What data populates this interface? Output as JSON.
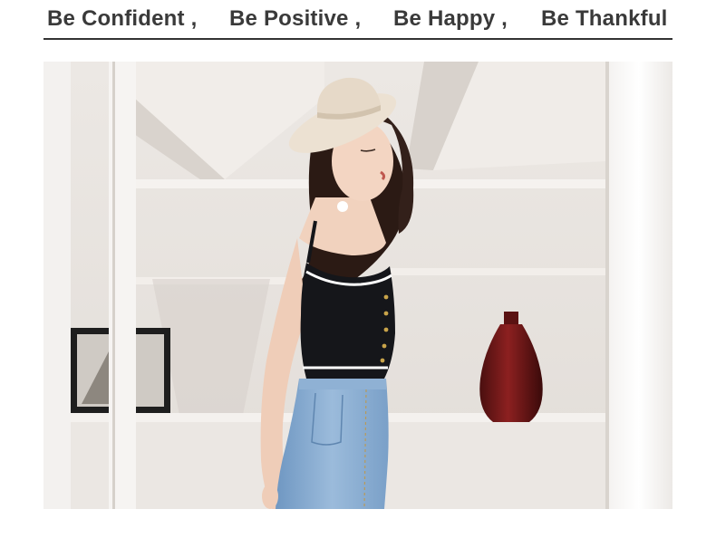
{
  "slogans": [
    "Be Confident ,",
    "Be Positive ,",
    "Be Happy ,",
    "Be Thankful"
  ],
  "photo": {
    "subject_icon": "model-photo-icon"
  },
  "colors": {
    "slogan_text": "#3a3a3a",
    "rule": "#333333",
    "wall": "#e9e5e1",
    "frame": "#f4f2f0"
  }
}
